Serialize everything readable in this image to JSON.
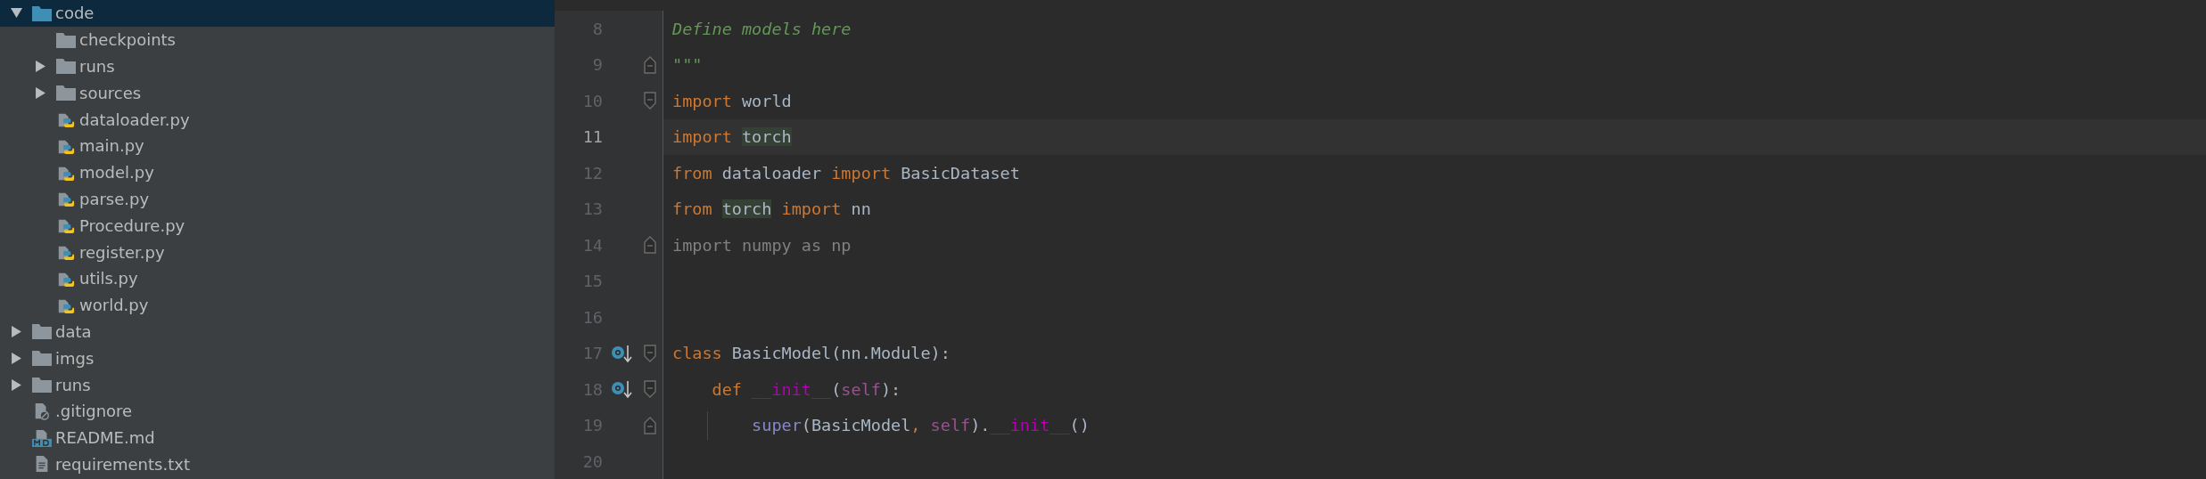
{
  "project_tree": [
    {
      "name": "code",
      "kind": "source-folder",
      "expanded": true,
      "selected": true,
      "children": [
        {
          "name": "checkpoints",
          "kind": "empty-folder",
          "selected": false
        },
        {
          "name": "runs",
          "kind": "folder",
          "expanded": false,
          "selected": false
        },
        {
          "name": "sources",
          "kind": "folder",
          "expanded": false,
          "selected": false
        },
        {
          "name": "dataloader.py",
          "kind": "python",
          "selected": false
        },
        {
          "name": "main.py",
          "kind": "python",
          "selected": false
        },
        {
          "name": "model.py",
          "kind": "python",
          "selected": false
        },
        {
          "name": "parse.py",
          "kind": "python",
          "selected": false
        },
        {
          "name": "Procedure.py",
          "kind": "python",
          "selected": false
        },
        {
          "name": "register.py",
          "kind": "python",
          "selected": false
        },
        {
          "name": "utils.py",
          "kind": "python",
          "selected": false
        },
        {
          "name": "world.py",
          "kind": "python",
          "selected": false
        }
      ]
    },
    {
      "name": "data",
      "kind": "folder",
      "expanded": false,
      "selected": false
    },
    {
      "name": "imgs",
      "kind": "folder",
      "expanded": false,
      "selected": false
    },
    {
      "name": "runs",
      "kind": "folder",
      "expanded": false,
      "selected": false
    },
    {
      "name": ".gitignore",
      "kind": "gitignore",
      "selected": false
    },
    {
      "name": "README.md",
      "kind": "markdown",
      "selected": false
    },
    {
      "name": "requirements.txt",
      "kind": "text",
      "selected": false
    }
  ],
  "editor": {
    "lines": [
      {
        "number": "8",
        "current": false,
        "tokens": [
          {
            "text": "Define models here",
            "kind": "docstring"
          }
        ]
      },
      {
        "number": "9",
        "current": false,
        "fold_end": true,
        "tokens": [
          {
            "text": "\"\"\"",
            "kind": "docstring"
          }
        ]
      },
      {
        "number": "10",
        "current": false,
        "fold_start": true,
        "tokens": [
          {
            "text": "import",
            "kind": "keyword"
          },
          {
            "text": " world",
            "kind": "name"
          }
        ]
      },
      {
        "number": "11",
        "current": true,
        "tokens": [
          {
            "text": "import ",
            "kind": "keyword"
          },
          {
            "text": "torch",
            "kind": "name",
            "highlighted": true
          }
        ]
      },
      {
        "number": "12",
        "current": false,
        "tokens": [
          {
            "text": "from",
            "kind": "keyword"
          },
          {
            "text": " dataloader ",
            "kind": "name"
          },
          {
            "text": "import",
            "kind": "keyword"
          },
          {
            "text": " BasicDataset",
            "kind": "name"
          }
        ]
      },
      {
        "number": "13",
        "current": false,
        "tokens": [
          {
            "text": "from ",
            "kind": "keyword"
          },
          {
            "text": "torch",
            "kind": "name",
            "highlighted": true
          },
          {
            "text": " import",
            "kind": "keyword"
          },
          {
            "text": " nn",
            "kind": "name"
          }
        ]
      },
      {
        "number": "14",
        "current": false,
        "fold_end": true,
        "tokens": [
          {
            "text": "import numpy as np",
            "kind": "unused"
          }
        ]
      },
      {
        "number": "15",
        "current": false
      },
      {
        "number": "16",
        "current": false
      },
      {
        "number": "17",
        "current": false,
        "fold_start": true,
        "override": true,
        "tokens": [
          {
            "text": "class",
            "kind": "keyword"
          },
          {
            "text": " BasicModel(nn.Module):",
            "kind": "name"
          }
        ]
      },
      {
        "number": "18",
        "current": false,
        "fold_start": true,
        "override": true,
        "tokens": [
          {
            "text": "    def ",
            "kind": "keyword"
          },
          {
            "text": "__init__",
            "kind": "magic"
          },
          {
            "text": "(",
            "kind": "name"
          },
          {
            "text": "self",
            "kind": "self"
          },
          {
            "text": "):",
            "kind": "name"
          }
        ]
      },
      {
        "number": "19",
        "current": false,
        "fold_end": true,
        "guide": true,
        "tokens": [
          {
            "text": "        super",
            "kind": "builtin"
          },
          {
            "text": "(BasicModel",
            "kind": "name"
          },
          {
            "text": ", ",
            "kind": "keyword"
          },
          {
            "text": "self",
            "kind": "self"
          },
          {
            "text": ").",
            "kind": "name"
          },
          {
            "text": "__init__",
            "kind": "magic"
          },
          {
            "text": "()",
            "kind": "name"
          }
        ]
      },
      {
        "number": "20",
        "current": false
      }
    ]
  }
}
